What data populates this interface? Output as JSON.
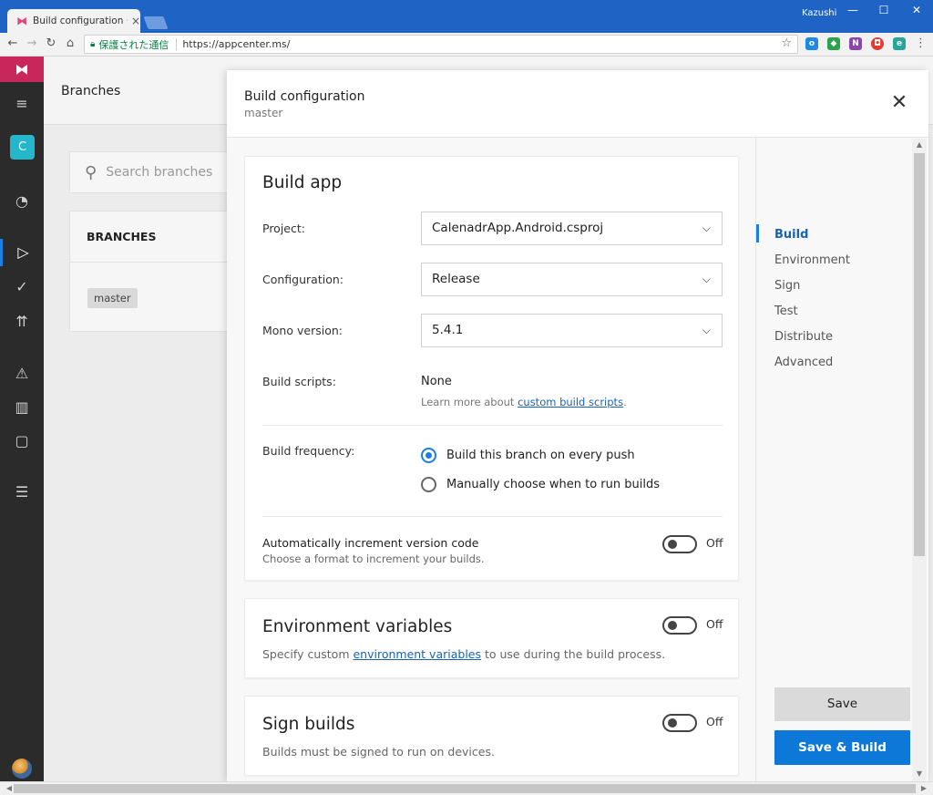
{
  "browser": {
    "tab_title": "Build configuration · Calendar",
    "tab_close": "×",
    "profile_name": "Kazushi",
    "secure_label": "保護された通信",
    "url": "https://appcenter.ms/",
    "window_controls": {
      "minimize": "—",
      "maximize": "☐",
      "close": "✕"
    },
    "nav_icons": {
      "back": "←",
      "forward": "→",
      "reload": "↻",
      "home": "⌂",
      "star": "☆",
      "menu": "⋮"
    }
  },
  "rail": {
    "logo_icon": "appcenter-logo-icon",
    "logo_glyph": "⧓",
    "menu_glyph": "≡",
    "app_initial": "C",
    "items": [
      {
        "name": "overview-icon",
        "glyph": "◔"
      },
      {
        "name": "build-icon",
        "glyph": "▷"
      },
      {
        "name": "test-icon",
        "glyph": "✓"
      },
      {
        "name": "distribute-icon",
        "glyph": "⇈"
      },
      {
        "name": "diagnostics-icon",
        "glyph": "⚠"
      },
      {
        "name": "analytics-icon",
        "glyph": "▥"
      },
      {
        "name": "push-icon",
        "glyph": "▢"
      },
      {
        "name": "settings-icon",
        "glyph": "☰"
      }
    ]
  },
  "background": {
    "page_title": "Branches",
    "search_placeholder": "Search branches",
    "branches_heading": "BRANCHES",
    "branch_chip": "master"
  },
  "modal": {
    "title": "Build configuration",
    "subtitle": "master",
    "close_glyph": "✕",
    "build_app": {
      "title": "Build app",
      "project_label": "Project:",
      "project_value": "CalenadrApp.Android.csproj",
      "configuration_label": "Configuration:",
      "configuration_value": "Release",
      "mono_label": "Mono version:",
      "mono_value": "5.4.1",
      "scripts_label": "Build scripts:",
      "scripts_value": "None",
      "scripts_hint_prefix": "Learn more about ",
      "scripts_hint_link": "custom build scripts",
      "scripts_hint_suffix": ".",
      "frequency_label": "Build frequency:",
      "frequency_options": [
        "Build this branch on every push",
        "Manually choose when to run builds"
      ],
      "frequency_selected": 0,
      "auto_increment_label": "Automatically increment version code",
      "auto_increment_sub": "Choose a format to increment your builds.",
      "auto_increment_state": "Off"
    },
    "env_vars": {
      "title": "Environment variables",
      "desc_prefix": "Specify custom ",
      "desc_link": "environment variables",
      "desc_suffix": " to use during the build process.",
      "state": "Off"
    },
    "sign_builds": {
      "title": "Sign builds",
      "desc": "Builds must be signed to run on devices.",
      "state": "Off"
    },
    "sidenav": {
      "items": [
        "Build",
        "Environment",
        "Sign",
        "Test",
        "Distribute",
        "Advanced"
      ],
      "active": "Build"
    },
    "save_label": "Save",
    "save_build_label": "Save & Build"
  },
  "colors": {
    "accent": "#0e78d8",
    "brand": "#c8275b",
    "chrome_titlebar": "#1f63c4"
  }
}
